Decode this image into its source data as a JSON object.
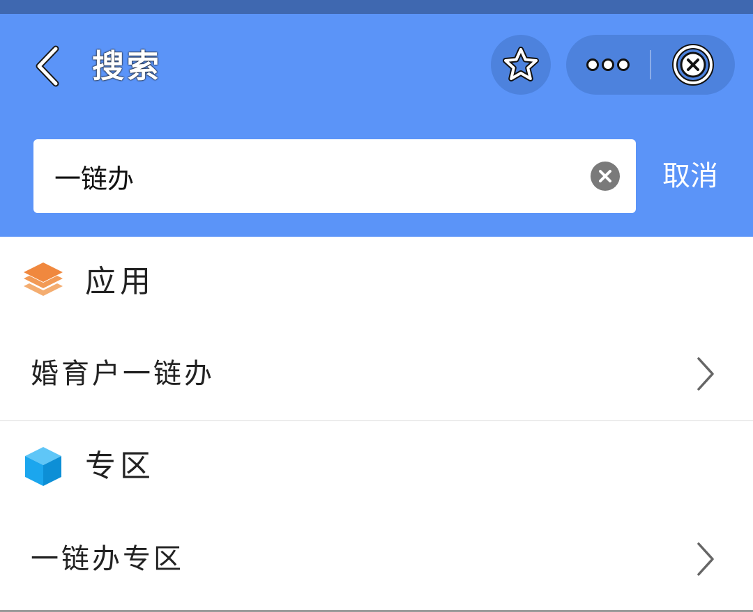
{
  "header": {
    "title": "搜索",
    "back_icon": "back-chevron-icon",
    "favorite_icon": "star-icon",
    "more_icon": "more-dots-icon",
    "close_icon": "close-circle-icon"
  },
  "search": {
    "value": "一链办",
    "clear_icon": "clear-circle-icon",
    "cancel_label": "取消"
  },
  "sections": [
    {
      "title": "应用",
      "icon": "layers-icon",
      "icon_color": "#f0883e",
      "items": [
        {
          "label": "婚育户一链办"
        }
      ]
    },
    {
      "title": "专区",
      "icon": "cube-icon",
      "icon_color": "#1ba6ee",
      "items": [
        {
          "label": "一链办专区"
        }
      ]
    }
  ],
  "colors": {
    "header_bg": "#5b94f8",
    "capsule_bg": "#4d82dd",
    "statusbar_bg": "#3f68b0"
  }
}
